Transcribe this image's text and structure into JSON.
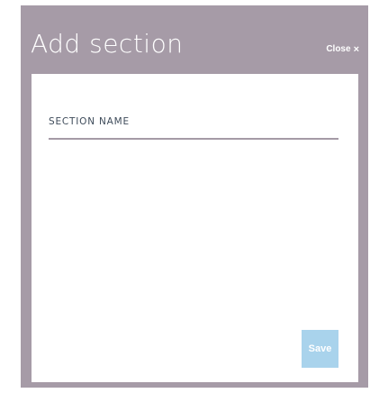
{
  "modal": {
    "title": "Add section",
    "close_label": "Close",
    "close_glyph": "×",
    "colors": {
      "overlay": "#a69ba7",
      "panel": "#ffffff",
      "save_button": "#a9d3ec",
      "label_text": "#3e4b5a"
    }
  },
  "form": {
    "section_name": {
      "label": "SECTION NAME",
      "value": ""
    },
    "save_label": "Save"
  }
}
